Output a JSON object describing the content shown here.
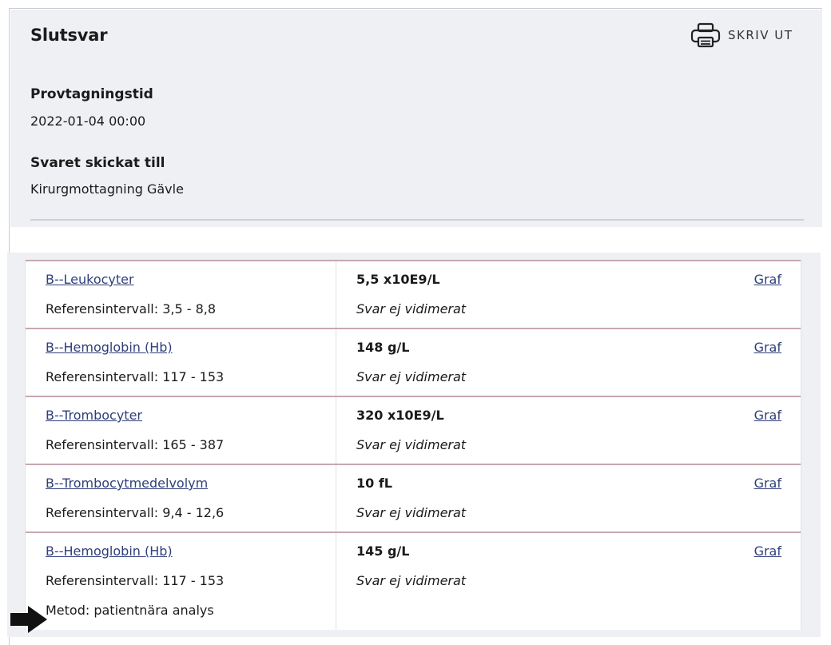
{
  "header": {
    "title": "Slutsvar",
    "print_label": "SKRIV UT",
    "sampling_time_label": "Provtagningstid",
    "sampling_time_value": "2022-01-04 00:00",
    "sent_to_label": "Svaret skickat till",
    "sent_to_value": "Kirurgmottagning Gävle"
  },
  "results": [
    {
      "name": "B--Leukocyter",
      "reference": "Referensintervall: 3,5 - 8,8",
      "value": "5,5 x10E9/L",
      "status": "Svar ej vidimerat",
      "graph_label": "Graf"
    },
    {
      "name": "B--Hemoglobin (Hb)",
      "reference": "Referensintervall: 117 - 153",
      "value": "148 g/L",
      "status": "Svar ej vidimerat",
      "graph_label": "Graf"
    },
    {
      "name": "B--Trombocyter",
      "reference": "Referensintervall: 165 - 387",
      "value": "320 x10E9/L",
      "status": "Svar ej vidimerat",
      "graph_label": "Graf"
    },
    {
      "name": "B--Trombocytmedelvolym",
      "reference": "Referensintervall: 9,4 - 12,6",
      "value": "10 fL",
      "status": "Svar ej vidimerat",
      "graph_label": "Graf"
    },
    {
      "name": "B--Hemoglobin (Hb)",
      "reference": "Referensintervall: 117 - 153",
      "method": "Metod: patientnära analys",
      "value": "145 g/L",
      "status": "Svar ej vidimerat",
      "graph_label": "Graf"
    }
  ],
  "colors": {
    "panel_background": "#eef0f4",
    "row_border": "#c7a7b0",
    "link": "#2f3f7a"
  },
  "icons": {
    "print": "printer-icon",
    "pointer": "arrow-right-icon"
  }
}
